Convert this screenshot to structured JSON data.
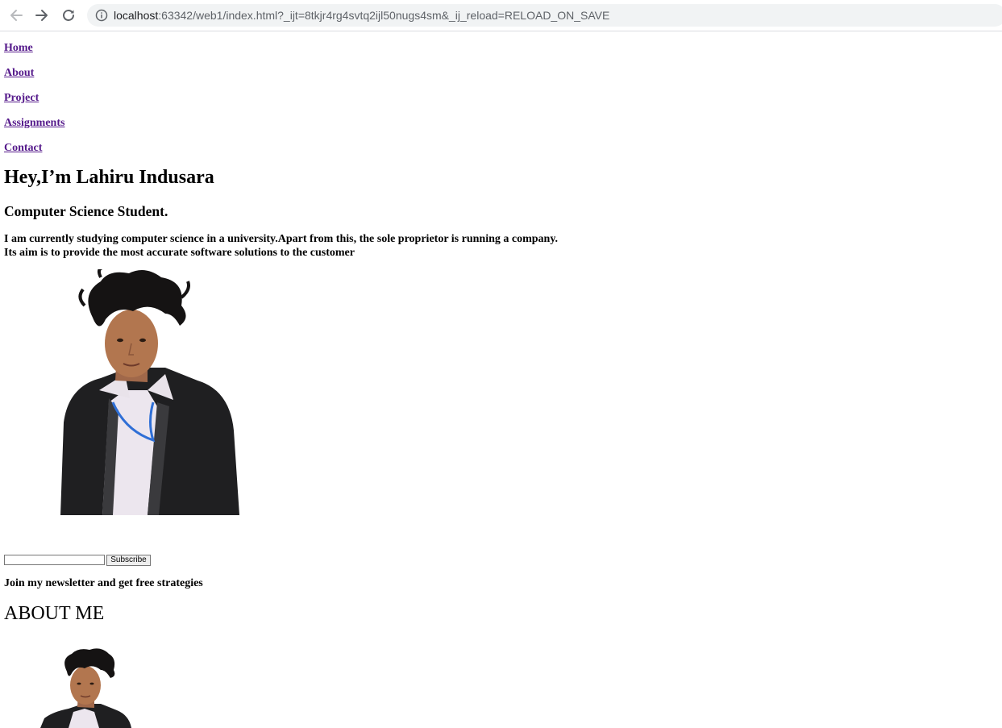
{
  "browser": {
    "url_host": "localhost",
    "url_rest": ":63342/web1/index.html?_ijt=8tkjr4rg4svtq2ijl50nugs4sm&_ij_reload=RELOAD_ON_SAVE"
  },
  "nav": {
    "items": [
      "Home",
      "About",
      "Project",
      "Assignments",
      "Contact"
    ]
  },
  "hero": {
    "title": "Hey,I’m Lahiru Indusara",
    "subtitle": "Computer Science Student.",
    "description_line1": "I am currently studying computer science in a university.Apart from this, the sole proprietor is running a company.",
    "description_line2": "Its aim is to provide the most accurate software solutions to the customer"
  },
  "newsletter": {
    "input_value": "",
    "subscribe_label": "Subscribe",
    "text": "Join my newsletter and get free strategies"
  },
  "about": {
    "title": "ABOUT ME"
  },
  "icons": {
    "back": "arrow-left-icon",
    "forward": "arrow-right-icon",
    "reload": "reload-icon",
    "info": "info-icon"
  }
}
